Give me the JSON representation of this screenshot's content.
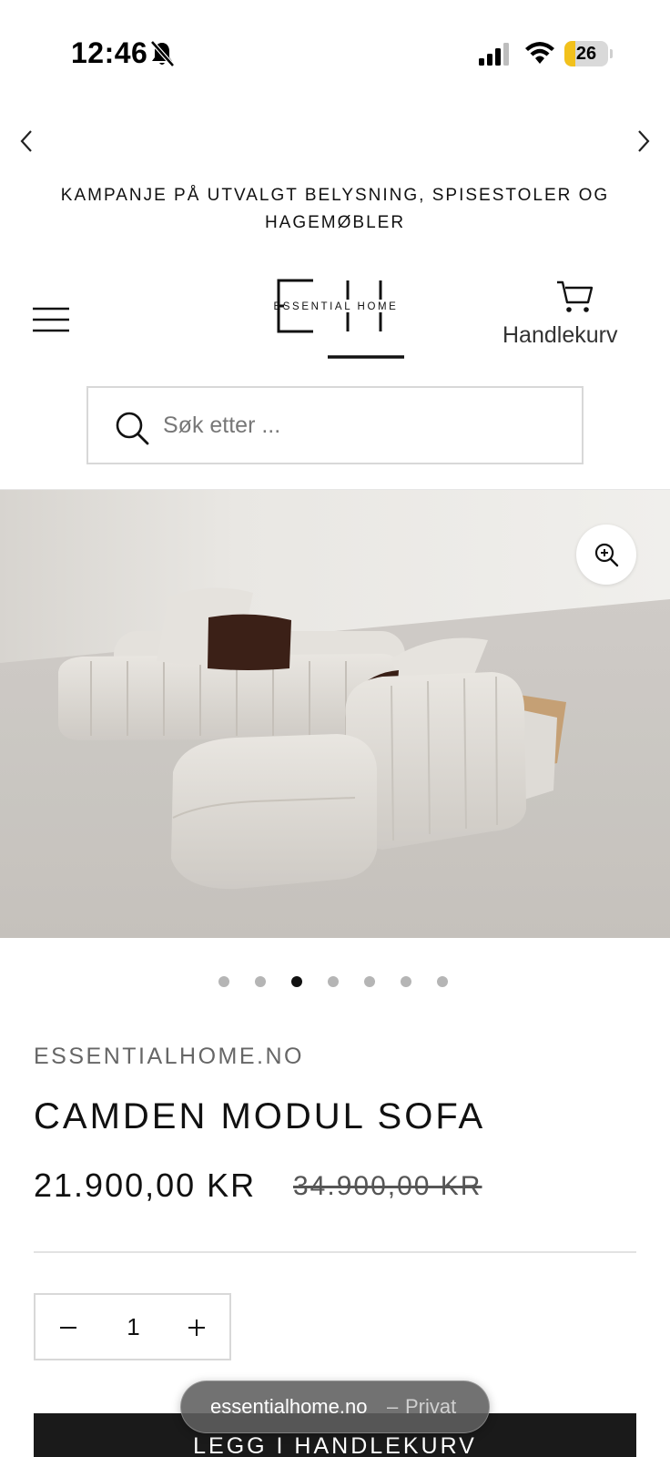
{
  "status_bar": {
    "time": "12:46",
    "battery_level": "26",
    "battery_fraction": 0.26,
    "battery_color": "#f2c11c",
    "icons": [
      "bell-slash-icon",
      "cellular-signal-icon",
      "wifi-icon",
      "battery-icon"
    ]
  },
  "announcement": {
    "text": "KAMPANJE PÅ UTVALGT BELYSNING, SPISESTOLER OG HAGEMØBLER",
    "icons": [
      "chevron-left-icon",
      "chevron-right-icon"
    ]
  },
  "header": {
    "logo_text": "ESSENTIAL HOME",
    "cart_label": "Handlekurv",
    "icons": [
      "hamburger-menu-icon",
      "cart-icon"
    ]
  },
  "search": {
    "placeholder": "Søk etter ...",
    "value": "",
    "icon": "search-icon"
  },
  "product": {
    "image_alt": "Camden modul sofa in light boucle fabric, corner configuration with cushions",
    "zoom_icon": "zoom-in-icon",
    "gallery_total": 7,
    "gallery_active_index": 2,
    "vendor": "ESSENTIALHOME.NO",
    "title": "CAMDEN MODUL SOFA",
    "price": "21.900,00 KR",
    "compare_at_price": "34.900,00 KR"
  },
  "quantity": {
    "value": "1",
    "icons": [
      "minus-icon",
      "plus-icon"
    ]
  },
  "add_to_cart": {
    "label": "LEGG I HANDLEKURV",
    "color": "#1a1a1a"
  },
  "browser": {
    "domain": "essentialhome.no",
    "separator": "–",
    "mode": "Privat"
  }
}
